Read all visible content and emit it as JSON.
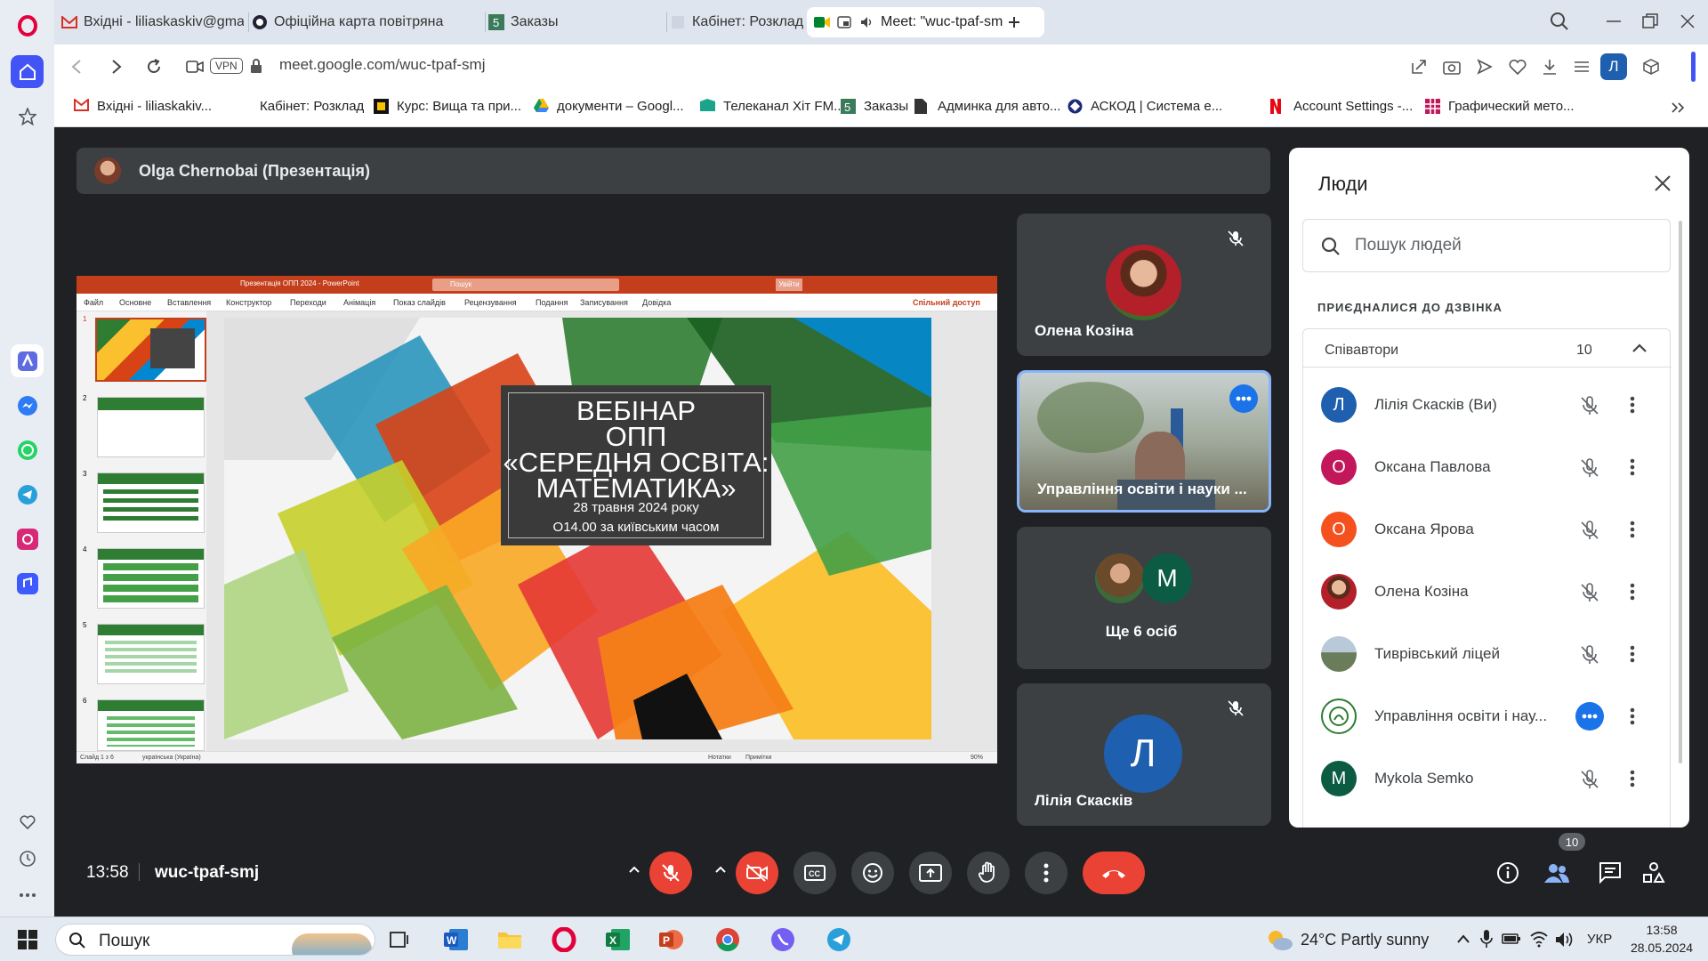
{
  "browser": {
    "tabs": [
      {
        "label": "Вхідні - liliaskaskiv@gmai",
        "icon": "gmail-icon"
      },
      {
        "label": "Офіційна карта повітряна",
        "icon": "map-icon"
      },
      {
        "label": "Заказы",
        "icon": "five-icon"
      },
      {
        "label": "Кабінет: Розклад",
        "icon": "page-icon"
      },
      {
        "label": "Meet: \"wuc-tpaf-sm",
        "icon": "meet-icon"
      }
    ],
    "url": "meet.google.com/wuc-tpaf-smj",
    "vpn_label": "VPN",
    "profile_initial": "Л",
    "bookmarks": [
      {
        "label": "Вхідні - liliaskakiv...",
        "icon": "gmail-icon"
      },
      {
        "label": "Кабінет: Розклад",
        "icon": "page-icon"
      },
      {
        "label": "Курс: Вища та при...",
        "icon": "course-icon"
      },
      {
        "label": "документи – Googl...",
        "icon": "drive-icon"
      },
      {
        "label": "Телеканал Хіт FM...",
        "icon": "tv-icon"
      },
      {
        "label": "Заказы",
        "icon": "five-icon"
      },
      {
        "label": "Админка для авто...",
        "icon": "doc-icon"
      },
      {
        "label": "АСКОД | Система е...",
        "icon": "askod-icon"
      },
      {
        "label": "Account Settings -...",
        "icon": "netflix-icon"
      },
      {
        "label": "Графический мето...",
        "icon": "grid-icon"
      }
    ]
  },
  "meet": {
    "presenter": "Olga Chernobai (Презентація)",
    "slide": {
      "app_title": "Презентація ОПП 2024 - PowerPoint",
      "search": "Пошук",
      "signin": "Увійти",
      "menu": [
        "Файл",
        "Основне",
        "Вставлення",
        "Конструктор",
        "Переходи",
        "Анімація",
        "Показ слайдів",
        "Рецензування",
        "Подання",
        "Записування",
        "Довідка"
      ],
      "share": "Спільний доступ",
      "thumb_numbers": [
        "1",
        "2",
        "3",
        "4",
        "5",
        "6"
      ],
      "title_lines": [
        "ВЕБІНАР",
        "ОПП",
        "«СЕРЕДНЯ ОСВІТА:",
        "МАТЕМАТИКА»"
      ],
      "date": "28 травня 2024 року",
      "time": "О14.00 за київським часом",
      "status_left": "Слайд 1 з 6",
      "status_lang": "українська (Україна)",
      "status_notes": "Нотатки",
      "status_comments": "Примітки",
      "zoom": "90%"
    },
    "tiles": [
      {
        "name": "Олена Козіна"
      },
      {
        "name": "Управління освіти і науки ..."
      },
      {
        "name": "Ще 6 осіб",
        "initial": "М"
      },
      {
        "name": "Лілія Скасків",
        "initial": "Л"
      }
    ],
    "people_panel": {
      "title": "Люди",
      "search_placeholder": "Пошук людей",
      "section": "ПРИЄДНАЛИСЯ ДО ДЗВІНКА",
      "group": "Співавтори",
      "count": "10",
      "people": [
        {
          "name": "Лілія Скасків (Ви)",
          "initial": "Л",
          "color": "#1f5faf"
        },
        {
          "name": "Оксана Павлова",
          "initial": "О",
          "color": "#c2185b"
        },
        {
          "name": "Оксана Ярова",
          "initial": "О",
          "color": "#f4511e"
        },
        {
          "name": "Олена Козіна",
          "initial": "",
          "color": "#8d4e3a"
        },
        {
          "name": "Тиврівський ліцей",
          "initial": "",
          "color": "#6d7f8f"
        },
        {
          "name": "Управління освіти і нау...",
          "initial": "",
          "color": "#ffffff"
        },
        {
          "name": "Mykola Semko",
          "initial": "M",
          "color": "#0b5c43"
        }
      ]
    },
    "time": "13:58",
    "meeting_code": "wuc-tpaf-smj",
    "participants_badge": "10"
  },
  "taskbar": {
    "search": "Пошук",
    "weather": "24°C  Partly sunny",
    "lang": "УКР",
    "time": "13:58",
    "date": "28.05.2024"
  }
}
